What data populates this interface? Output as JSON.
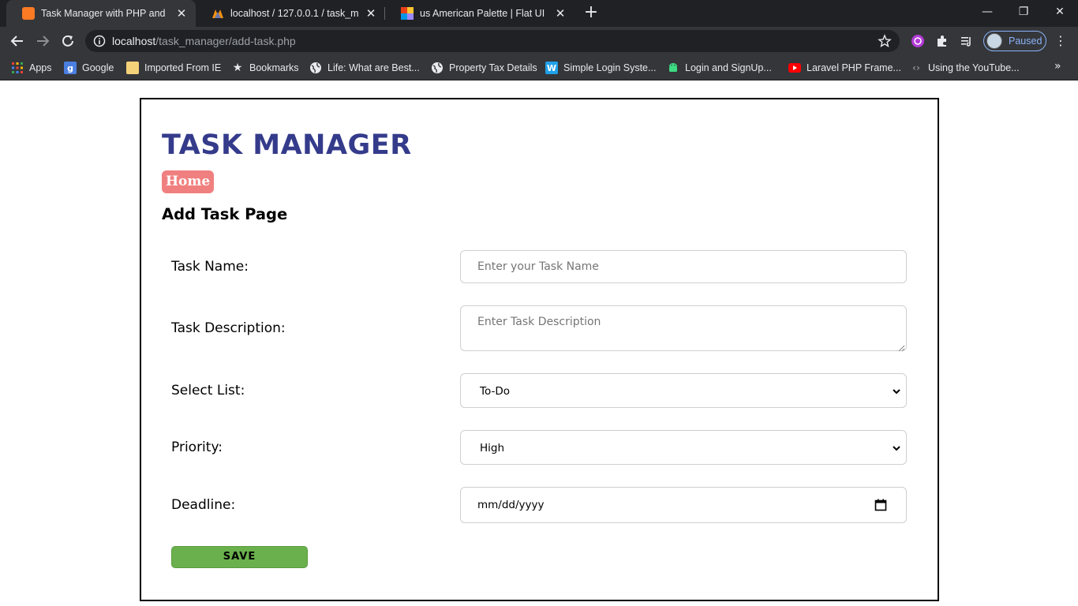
{
  "browser": {
    "tabs": [
      {
        "title": "Task Manager with PHP and MyS",
        "active": true
      },
      {
        "title": "localhost / 127.0.0.1 / task_mana",
        "active": false
      },
      {
        "title": "us American Palette | Flat UI Colo",
        "active": false
      }
    ],
    "address": {
      "host": "localhost",
      "path": "/task_manager/add-task.php"
    },
    "profile_status": "Paused",
    "bookmarks": [
      {
        "label": "Apps"
      },
      {
        "label": "Google"
      },
      {
        "label": "Imported From IE"
      },
      {
        "label": "Bookmarks"
      },
      {
        "label": "Life: What are Best..."
      },
      {
        "label": "Property Tax Details"
      },
      {
        "label": "Simple Login Syste..."
      },
      {
        "label": "Login and SignUp..."
      },
      {
        "label": "Laravel PHP Frame..."
      },
      {
        "label": "Using the YouTube..."
      }
    ]
  },
  "app": {
    "title": "TASK MANAGER",
    "home_label": "Home",
    "page_title": "Add Task Page"
  },
  "form": {
    "task_name": {
      "label": "Task Name:",
      "placeholder": "Enter your Task Name"
    },
    "task_description": {
      "label": "Task Description:",
      "placeholder": "Enter Task Description"
    },
    "select_list": {
      "label": "Select List:",
      "value": "To-Do"
    },
    "priority": {
      "label": "Priority:",
      "value": "High"
    },
    "deadline": {
      "label": "Deadline:",
      "value": "mm/dd/yyyy"
    },
    "save_label": "SAVE"
  },
  "colors": {
    "title": "#353b8b",
    "home_button": "#f0807f",
    "save_button": "#6ab04c",
    "chrome_dark": "#202124",
    "chrome_toolbar": "#35363a"
  }
}
